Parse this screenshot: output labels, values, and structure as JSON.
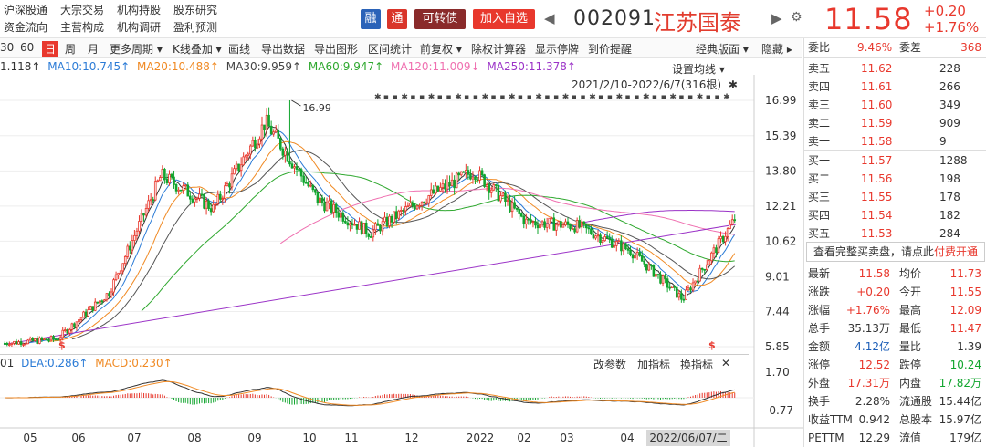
{
  "header": {
    "nav": [
      "沪深股通",
      "大宗交易",
      "机构持股",
      "股东研究",
      "资金流向",
      "主营构成",
      "机构调研",
      "盈利预测"
    ],
    "tag_rong": "融",
    "tag_tong": "通",
    "tag_convertible": "可转债",
    "add_watch": "加入自选",
    "code": "002091",
    "name": "江苏国泰",
    "price": "11.58",
    "change": "+0.20",
    "change_pct": "+1.76%",
    "prev_arrow": "◀",
    "next_arrow": "▶",
    "gear": "⚙"
  },
  "toolbar": {
    "items": [
      "30",
      "60",
      "日",
      "周",
      "月",
      "更多周期 ▾",
      "K线叠加 ▾",
      "画线",
      "导出数据",
      "导出图形",
      "区间统计",
      "前复权 ▾",
      "除权计算器",
      "显示停牌",
      "到价提醒",
      "经典版面 ▾",
      "隐藏 ▸"
    ]
  },
  "ma_legend": {
    "ma5": "1.118↑",
    "ma10": "MA10:10.745↑",
    "ma20": "MA20:10.488↑",
    "ma30": "MA30:9.959↑",
    "ma60": "MA60:9.947↑",
    "ma120": "MA120:11.009↓",
    "ma250": "MA250:11.378↑"
  },
  "chart": {
    "set_ma": "设置均线 ▾",
    "range": "2021/2/10-2022/6/7(316根)",
    "high_label": "16.99",
    "dollar": "$",
    "y_ticks": [
      "16.99",
      "15.39",
      "13.80",
      "12.21",
      "10.62",
      "9.01",
      "7.44",
      "5.85"
    ],
    "x_ticks": [
      "05",
      "06",
      "07",
      "08",
      "09",
      "10",
      "11",
      "12",
      "2022",
      "02",
      "03",
      "04"
    ],
    "current_date": "2022/06/07/二"
  },
  "chart_data": {
    "type": "candlestick",
    "title": "",
    "xlabel": "",
    "ylabel": "",
    "ylim": [
      5.85,
      16.99
    ],
    "period": "2021/2/10-2022/6/7",
    "bars": 316,
    "high": 16.99,
    "last_close": 11.58,
    "series": [
      {
        "name": "close",
        "approx_monthly": [
          6.0,
          6.2,
          8.3,
          13.6,
          12.1,
          16.0,
          12.5,
          11.0,
          12.5,
          13.8,
          11.5,
          11.3,
          10.2,
          8.0,
          11.6
        ]
      },
      {
        "name": "MA5",
        "value": 11.118
      },
      {
        "name": "MA10",
        "value": 10.745
      },
      {
        "name": "MA20",
        "value": 10.488
      },
      {
        "name": "MA30",
        "value": 9.959
      },
      {
        "name": "MA60",
        "value": 9.947
      },
      {
        "name": "MA120",
        "value": 11.009
      },
      {
        "name": "MA250",
        "value": 11.378
      }
    ],
    "macd": {
      "DIF_label": "01",
      "DEA": 0.286,
      "MACD": 0.23,
      "y_ticks": [
        "1.70",
        "-0.77"
      ]
    }
  },
  "macd": {
    "dif": "01",
    "dea": "DEA:0.286↑",
    "macd": "MACD:0.230↑",
    "btn_params": "改参数",
    "btn_add": "加指标",
    "btn_switch": "换指标",
    "close": "✕"
  },
  "book": {
    "ratio_label": "委比",
    "ratio_val": "9.46%",
    "diff_label": "委差",
    "diff_val": "368",
    "asks": [
      {
        "label": "卖五",
        "price": "11.62",
        "vol": "228"
      },
      {
        "label": "卖四",
        "price": "11.61",
        "vol": "266"
      },
      {
        "label": "卖三",
        "price": "11.60",
        "vol": "349"
      },
      {
        "label": "卖二",
        "price": "11.59",
        "vol": "909"
      },
      {
        "label": "卖一",
        "price": "11.58",
        "vol": "9"
      }
    ],
    "bids": [
      {
        "label": "买一",
        "price": "11.57",
        "vol": "1288"
      },
      {
        "label": "买二",
        "price": "11.56",
        "vol": "198"
      },
      {
        "label": "买三",
        "price": "11.55",
        "vol": "178"
      },
      {
        "label": "买四",
        "price": "11.54",
        "vol": "182"
      },
      {
        "label": "买五",
        "price": "11.53",
        "vol": "284"
      }
    ],
    "full_text": "查看完整买卖盘，请点此",
    "full_link": "付费开通"
  },
  "stats": [
    {
      "l1": "最新",
      "v1": "11.58",
      "c1": "red",
      "l2": "均价",
      "v2": "11.73",
      "c2": "red"
    },
    {
      "l1": "涨跌",
      "v1": "+0.20",
      "c1": "red",
      "l2": "今开",
      "v2": "11.55",
      "c2": "red"
    },
    {
      "l1": "涨幅",
      "v1": "+1.76%",
      "c1": "red",
      "l2": "最高",
      "v2": "12.09",
      "c2": "red"
    },
    {
      "l1": "总手",
      "v1": "35.13万",
      "c1": "",
      "l2": "最低",
      "v2": "11.47",
      "c2": "red"
    },
    {
      "l1": "金额",
      "v1": "4.12亿",
      "c1": "blue",
      "l2": "量比",
      "v2": "1.39",
      "c2": ""
    },
    {
      "l1": "涨停",
      "v1": "12.52",
      "c1": "red",
      "l2": "跌停",
      "v2": "10.24",
      "c2": "green"
    },
    {
      "l1": "外盘",
      "v1": "17.31万",
      "c1": "red",
      "l2": "内盘",
      "v2": "17.82万",
      "c2": "green"
    },
    {
      "l1": "换手",
      "v1": "2.28%",
      "c1": "",
      "l2": "流通股",
      "v2": "15.44亿",
      "c2": ""
    },
    {
      "l1": "收益TTM",
      "v1": "0.942",
      "c1": "",
      "l2": "总股本",
      "v2": "15.97亿",
      "c2": ""
    },
    {
      "l1": "PETTM",
      "v1": "12.29",
      "c1": "",
      "l2": "流值",
      "v2": "179亿",
      "c2": ""
    }
  ],
  "colors": {
    "red": "#e8382d",
    "green": "#11a52e",
    "ma5": "#333333",
    "ma10": "#2b7bd6",
    "ma20": "#f08a24",
    "ma30": "#555555",
    "ma60": "#2fa82f",
    "ma120": "#ef70b0",
    "ma250": "#9b33c7"
  }
}
